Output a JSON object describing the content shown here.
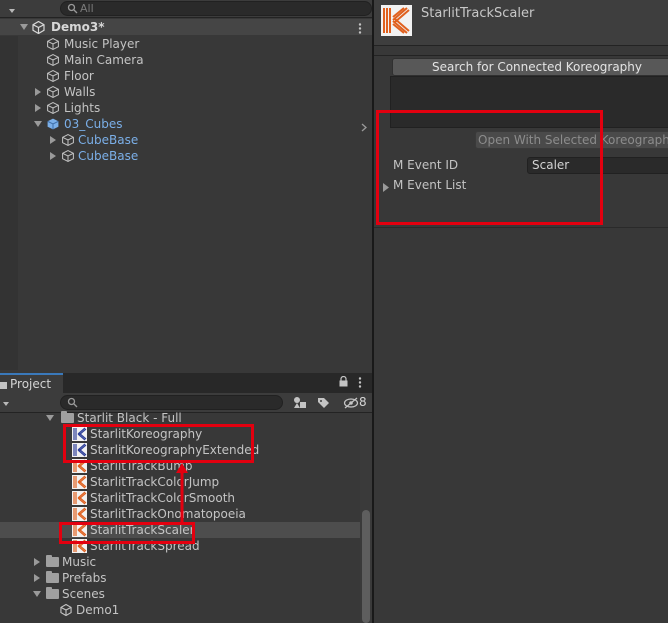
{
  "hierarchy": {
    "search_placeholder": "All",
    "scene_name": "Demo3*",
    "items": [
      {
        "label": "Music Player"
      },
      {
        "label": "Main Camera"
      },
      {
        "label": "Floor"
      },
      {
        "label": "Walls"
      },
      {
        "label": "Lights"
      },
      {
        "label": "03_Cubes"
      },
      {
        "label": "CubeBase"
      },
      {
        "label": "CubeBase"
      }
    ]
  },
  "project": {
    "tab_label": "Project",
    "hidden_count": "8",
    "folder_label": "Starlit Black - Full",
    "assets": [
      {
        "label": "StarlitKoreography"
      },
      {
        "label": "StarlitKoreographyExtended"
      },
      {
        "label": "StarlitTrackBump"
      },
      {
        "label": "StarlitTrackColorJump"
      },
      {
        "label": "StarlitTrackColorSmooth"
      },
      {
        "label": "StarlitTrackOnomatopoeia"
      },
      {
        "label": "StarlitTrackScaler"
      },
      {
        "label": "StarlitTrackSpread"
      }
    ],
    "folders": [
      {
        "label": "Music"
      },
      {
        "label": "Prefabs"
      },
      {
        "label": "Scenes"
      }
    ],
    "scene_items": [
      {
        "label": "Demo1"
      }
    ]
  },
  "inspector": {
    "title": "StarlitTrackScaler",
    "search_button": "Search for Connected Koreography",
    "open_button": "Open With Selected Koreography",
    "event_id_label": "M Event ID",
    "event_id_value": "Scaler",
    "event_list_label": "M Event List"
  },
  "colors": {
    "annotation": "#e3000f",
    "link_blue": "#7bafe8",
    "k_icon_orange": "#e0601e",
    "k_icon_blue": "#2d3f99"
  }
}
